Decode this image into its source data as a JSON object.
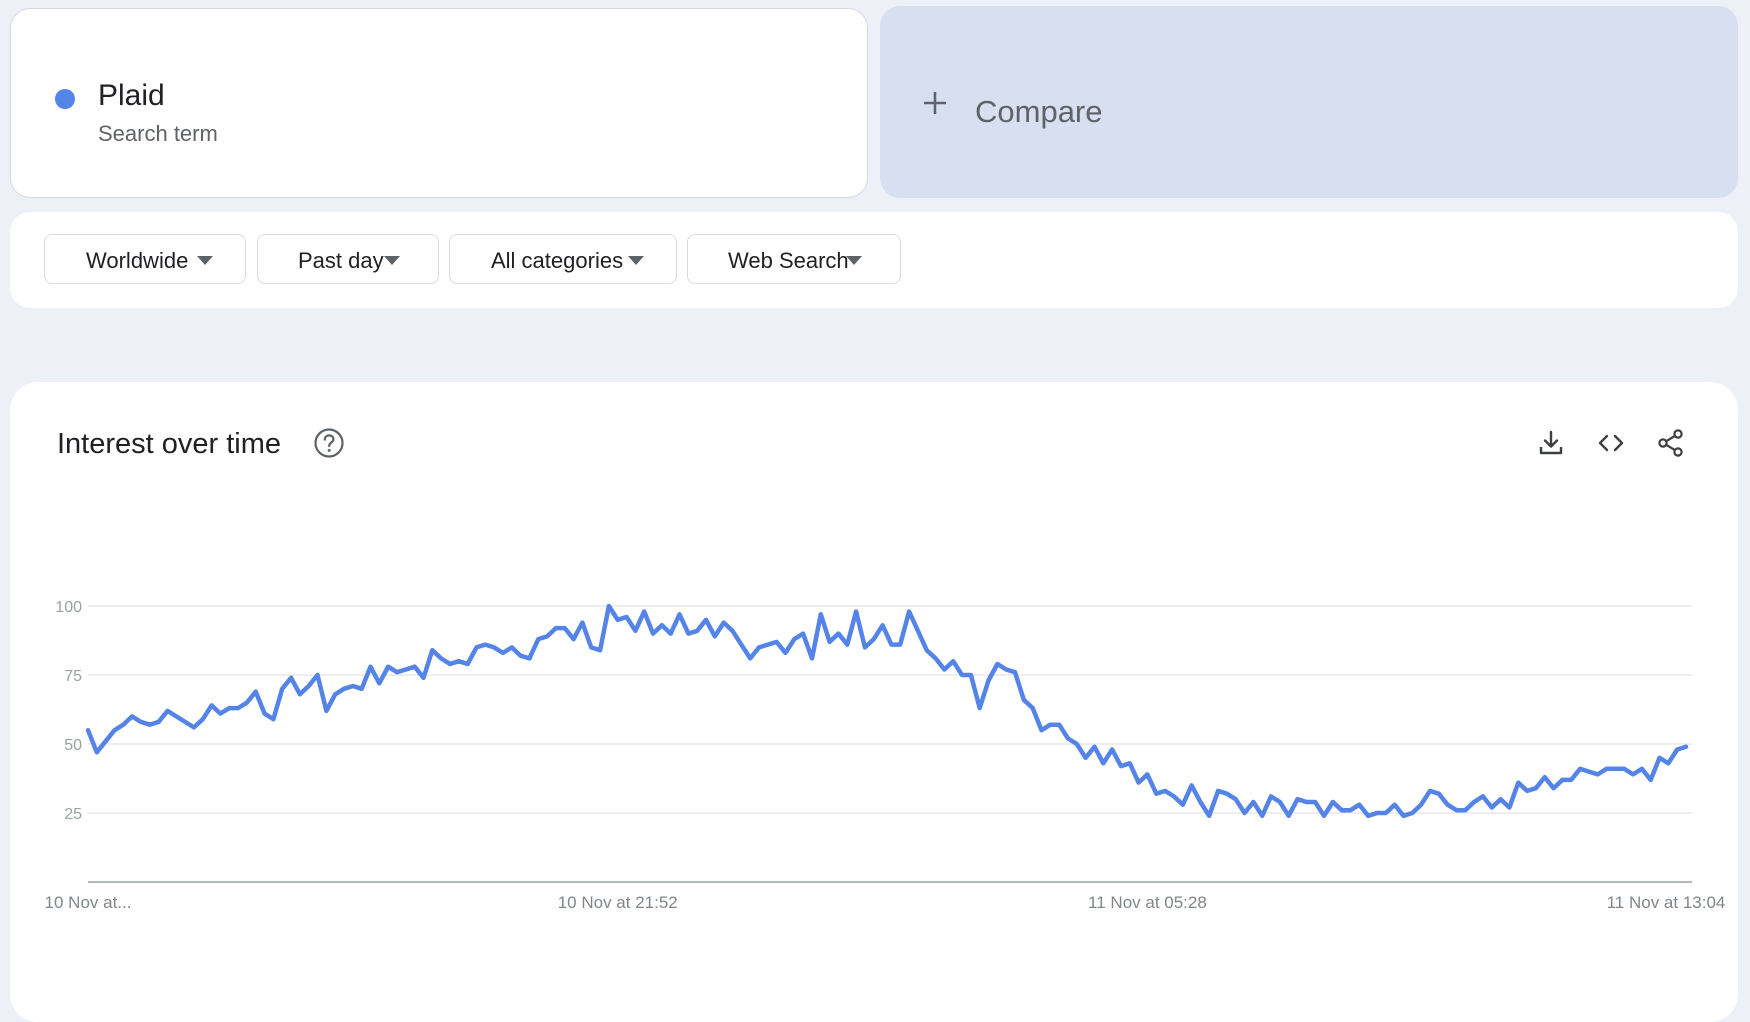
{
  "term": {
    "name": "Plaid",
    "subtitle": "Search term",
    "color": "#5584e9"
  },
  "compare": {
    "label": "Compare",
    "icon": "plus-icon"
  },
  "filters": [
    {
      "label": "Worldwide"
    },
    {
      "label": "Past day"
    },
    {
      "label": "All categories"
    },
    {
      "label": "Web Search"
    }
  ],
  "chart_card": {
    "title": "Interest over time",
    "help_icon": "help-circle-icon",
    "tools": [
      "download-icon",
      "embed-code-icon",
      "share-icon"
    ]
  },
  "chart_data": {
    "type": "line",
    "title": "Interest over time",
    "ylim": [
      0,
      100
    ],
    "y_ticks": [
      25,
      50,
      75,
      100
    ],
    "x_tick_labels": [
      {
        "label": "10 Nov at...",
        "index": 0
      },
      {
        "label": "10 Nov at 21:52",
        "index": 60
      },
      {
        "label": "11 Nov at 05:28",
        "index": 120
      },
      {
        "label": "11 Nov at 13:04",
        "index": 180
      }
    ],
    "grid": true,
    "series": [
      {
        "color": "#5584e9",
        "values": [
          55,
          47,
          51,
          55,
          57,
          60,
          58,
          57,
          58,
          62,
          60,
          58,
          56,
          59,
          64,
          61,
          63,
          63,
          65,
          69,
          61,
          59,
          70,
          74,
          68,
          71,
          75,
          62,
          68,
          70,
          71,
          70,
          78,
          72,
          78,
          76,
          77,
          78,
          74,
          84,
          81,
          79,
          80,
          79,
          85,
          86,
          85,
          83,
          85,
          82,
          81,
          88,
          89,
          92,
          92,
          88,
          94,
          85,
          84,
          100,
          95,
          96,
          91,
          98,
          90,
          93,
          90,
          97,
          90,
          91,
          95,
          89,
          94,
          91,
          86,
          81,
          85,
          86,
          87,
          83,
          88,
          90,
          81,
          97,
          87,
          90,
          86,
          98,
          85,
          88,
          93,
          86,
          86,
          98,
          91,
          84,
          81,
          77,
          80,
          75,
          75,
          63,
          73,
          79,
          77,
          76,
          66,
          63,
          55,
          57,
          57,
          52,
          50,
          45,
          49,
          43,
          48,
          42,
          43,
          36,
          39,
          32,
          33,
          31,
          28,
          35,
          29,
          24,
          33,
          32,
          30,
          25,
          29,
          24,
          31,
          29,
          24,
          30,
          29,
          29,
          24,
          29,
          26,
          26,
          28,
          24,
          25,
          25,
          28,
          24,
          25,
          28,
          33,
          32,
          28,
          26,
          26,
          29,
          31,
          27,
          30,
          27,
          36,
          33,
          34,
          38,
          34,
          37,
          37,
          41,
          40,
          39,
          41,
          41,
          41,
          39,
          41,
          37,
          45,
          43,
          48,
          49
        ]
      }
    ]
  }
}
